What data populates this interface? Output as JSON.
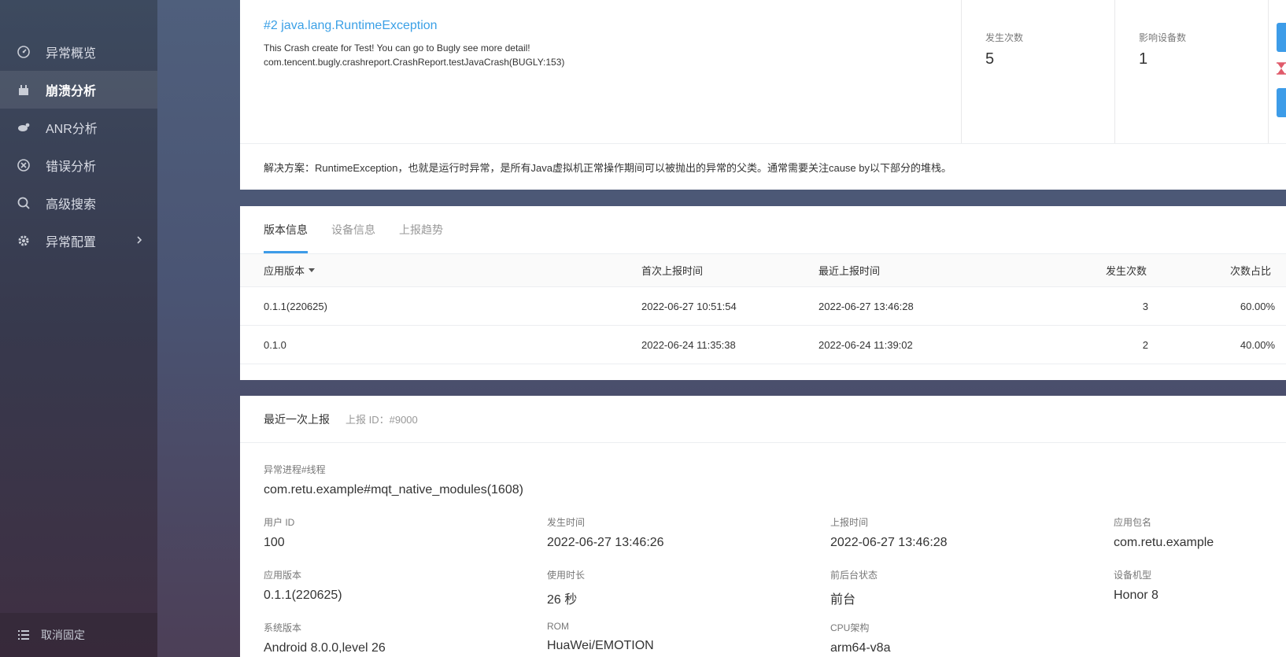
{
  "sidebar": {
    "items": [
      {
        "label": "异常概览",
        "icon": "dashboard-icon"
      },
      {
        "label": "崩溃分析",
        "icon": "crash-icon",
        "active": true
      },
      {
        "label": "ANR分析",
        "icon": "anr-icon"
      },
      {
        "label": "错误分析",
        "icon": "error-icon"
      },
      {
        "label": "高级搜索",
        "icon": "search-icon"
      },
      {
        "label": "异常配置",
        "icon": "gear-icon"
      }
    ],
    "footer": "取消固定"
  },
  "crash": {
    "title": "#2 java.lang.RuntimeException",
    "message": "This Crash create for Test! You can go to Bugly see more detail!",
    "stack_line": "com.tencent.bugly.crashreport.CrashReport.testJavaCrash(BUGLY:153)",
    "occurrences_label": "发生次数",
    "occurrences": "5",
    "devices_label": "影响设备数",
    "devices": "1",
    "solution": "解决方案：RuntimeException，也就是运行时异常，是所有Java虚拟机正常操作期间可以被抛出的异常的父类。通常需要关注cause by以下部分的堆栈。"
  },
  "versions": {
    "tabs": [
      "版本信息",
      "设备信息",
      "上报趋势"
    ],
    "columns": [
      "应用版本",
      "首次上报时间",
      "最近上报时间",
      "发生次数",
      "次数占比"
    ],
    "rows": [
      [
        "0.1.1(220625)",
        "2022-06-27 10:51:54",
        "2022-06-27 13:46:28",
        "3",
        "60.00%"
      ],
      [
        "0.1.0",
        "2022-06-24 11:35:38",
        "2022-06-24 11:39:02",
        "2",
        "40.00%"
      ]
    ]
  },
  "report": {
    "title": "最近一次上报",
    "id": "上报 ID：#9000",
    "process_label": "异常进程#线程",
    "process": "com.retu.example#mqt_native_modules(1608)",
    "fields": [
      {
        "label": "用户 ID",
        "value": "100"
      },
      {
        "label": "发生时间",
        "value": "2022-06-27 13:46:26"
      },
      {
        "label": "上报时间",
        "value": "2022-06-27 13:46:28"
      },
      {
        "label": "应用包名",
        "value": "com.retu.example"
      },
      {
        "label": "应用版本",
        "value": "0.1.1(220625)"
      },
      {
        "label": "使用时长",
        "value": "26 秒"
      },
      {
        "label": "前后台状态",
        "value": "前台"
      },
      {
        "label": "设备机型",
        "value": "Honor 8"
      },
      {
        "label": "系统版本",
        "value": "Android 8.0.0,level 26"
      },
      {
        "label": "ROM",
        "value": "HuaWei/EMOTION"
      },
      {
        "label": "CPU架构",
        "value": "arm64-v8a"
      }
    ]
  },
  "colors": {
    "accent": "#3d9ce8",
    "link": "#3ba0e6"
  }
}
